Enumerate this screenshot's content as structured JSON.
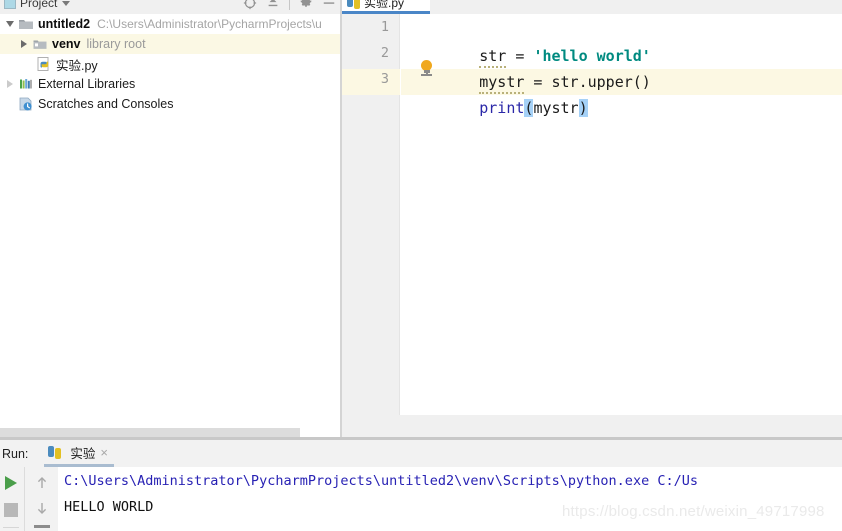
{
  "project_panel": {
    "title": "Project",
    "title_icon": "project-panel-icon",
    "caret_icon": "chevron-down-icon",
    "toolbar_icons": [
      "target-scroll-from-source-icon",
      "collapse-all-icon",
      "settings-gear-icon",
      "hide-panel-icon"
    ],
    "tree": [
      {
        "label": "untitled2",
        "path": "C:\\Users\\Administrator\\PycharmProjects\\u",
        "icon": "folder-module-icon",
        "twisty": "chevron-down-icon",
        "highlight": false,
        "indent": 0
      },
      {
        "label": "venv",
        "path": "library root",
        "icon": "folder-venv-icon",
        "twisty": "chevron-right-icon",
        "highlight": true,
        "indent": 1
      },
      {
        "label": "实验.py",
        "path": "",
        "icon": "python-file-icon",
        "twisty": "",
        "highlight": false,
        "indent": 2
      },
      {
        "label": "External Libraries",
        "path": "",
        "icon": "external-libraries-icon",
        "twisty": "chevron-right-icon",
        "highlight": false,
        "indent": 0
      },
      {
        "label": "Scratches and Consoles",
        "path": "",
        "icon": "scratches-consoles-icon",
        "twisty": "",
        "highlight": false,
        "indent": 0
      }
    ]
  },
  "editor": {
    "tab": {
      "label": "实验.py",
      "icon": "python-file-icon",
      "chevron": "⌃"
    },
    "gutter": [
      "1",
      "2",
      "3"
    ],
    "current_line": 3,
    "intention_bulb_icon": "lightbulb-intention-icon",
    "code": {
      "line1": {
        "ident": "str",
        "eq": " = ",
        "string": "'hello world'"
      },
      "line2": {
        "lhs": "mystr",
        "eq": " = ",
        "rhs": "str.upper()"
      },
      "line3": {
        "fn": "print",
        "open": "(",
        "arg": "mystr",
        "close": ")"
      }
    }
  },
  "run_panel": {
    "run_label": "Run:",
    "tab_label": "实验",
    "tab_icon": "python-file-icon",
    "close_icon": "×",
    "toolbar_icons": [
      "run-play-icon",
      "stop-icon",
      "scroll-up-icon",
      "scroll-down-icon",
      "soft-wrap-icon"
    ],
    "output": [
      {
        "text": "C:\\Users\\Administrator\\PycharmProjects\\untitled2\\venv\\Scripts\\python.exe C:/Us",
        "kind": "link"
      },
      {
        "text": "HELLO WORLD",
        "kind": "stdout"
      }
    ]
  },
  "watermark": "https://blog.csdn.net/weixin_49717998",
  "colors": {
    "string_token": "#008a80",
    "keyword_token": "#2822b4",
    "current_line_bg": "#fcf8e3",
    "tree_highlight_bg": "#fbf8e4",
    "brace_match_bg": "#a5d1f7",
    "console_link": "#2822b4",
    "run_play": "#4a9e4a",
    "tab_underline": "#4a86c7"
  }
}
